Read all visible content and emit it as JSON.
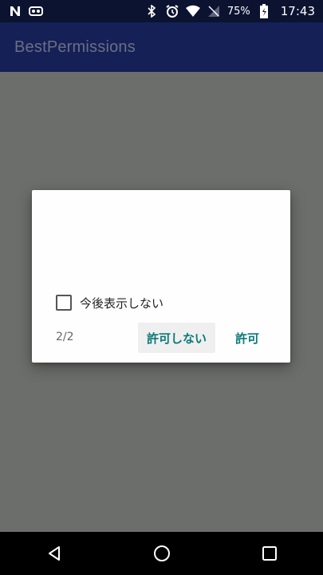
{
  "statusbar": {
    "left_icons": [
      "notification-n-icon",
      "voicemail-icon"
    ],
    "right_icons": [
      "bluetooth-icon",
      "alarm-icon",
      "wifi-icon",
      "no-sim-icon",
      "battery-icon"
    ],
    "battery": "75%",
    "time": "17:43"
  },
  "appbar": {
    "title": "BestPermissions"
  },
  "dialog": {
    "checkbox_label": "今後表示しない",
    "checkbox_checked": false,
    "page_indicator": "2/2",
    "deny_label": "許可しない",
    "allow_label": "許可",
    "accent_color": "#0b7a78"
  },
  "navbar": {
    "buttons": [
      "back-icon",
      "home-icon",
      "recents-icon"
    ]
  }
}
